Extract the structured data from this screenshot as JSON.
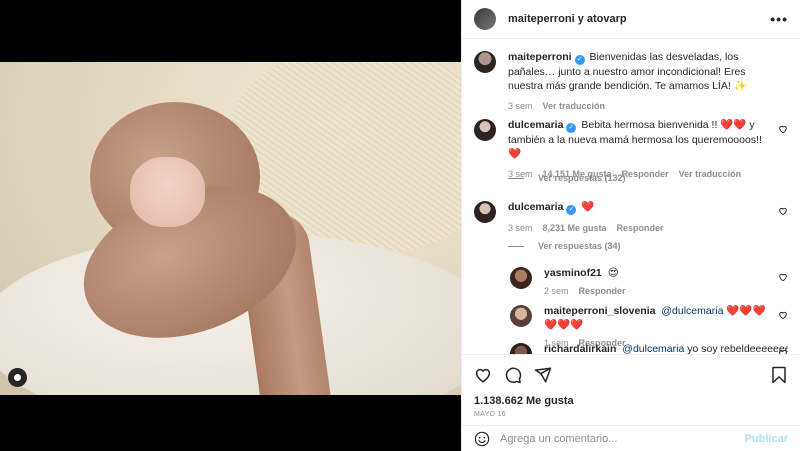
{
  "header": {
    "author": "maiteperroni",
    "connector": " y ",
    "coauthor": "atovarp",
    "more_icon": "more-horizontal-icon"
  },
  "caption": {
    "username": "maiteperroni",
    "text": "Bienvenidas las desveladas, los pañales… junto a nuestro amor incondicional! Eres nuestra más grande bendición. Te amamos LÍA! ✨",
    "time": "3 sem",
    "translate": "Ver traducción"
  },
  "comments": [
    {
      "username": "dulcemaria",
      "text": "Bebita hermosa bienvenida !! ❤️❤️ y también a la nueva mamá hermosa los queremoooos!!❤️",
      "time": "3 sem",
      "likes": "14,151 Me gusta",
      "reply": "Responder",
      "translate": "Ver traducción",
      "view_replies": "Ver respuestas (132)"
    },
    {
      "username": "dulcemaria",
      "text": "❤️",
      "time": "3 sem",
      "likes": "8,231 Me gusta",
      "reply": "Responder",
      "view_replies": "Ver respuestas (34)"
    }
  ],
  "replies": [
    {
      "username": "yasminof21",
      "text": "😍",
      "time": "2 sem",
      "reply": "Responder"
    },
    {
      "username": "maiteperroni_slovenia",
      "mention": "@dulcemaria",
      "text": " ❤️❤️❤️❤️❤️❤️",
      "time": "1 sem",
      "reply": "Responder"
    },
    {
      "username": "richardalirkain",
      "mention": "@dulcemaria",
      "text": " yo soy rebeldeeeeeee"
    }
  ],
  "actions": {
    "likes": "1.138.662 Me gusta",
    "date": "MAYO 16"
  },
  "compose": {
    "placeholder": "Agrega un comentario...",
    "publish": "Publicar"
  },
  "colors": {
    "verified": "#3897f0",
    "link": "#00376b",
    "publish_disabled": "#b2dffc",
    "muted": "#8e8e8e"
  }
}
